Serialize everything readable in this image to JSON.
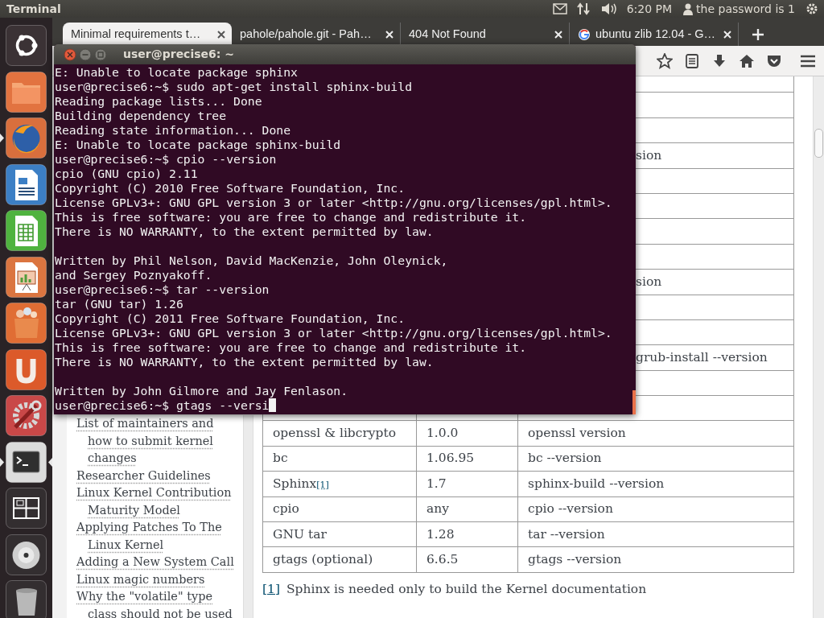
{
  "top_panel": {
    "app_title": "Terminal",
    "clock": "6:20 PM",
    "user_name": "the password is 1"
  },
  "launcher": [
    {
      "kind": "dash",
      "running": false,
      "focused": false
    },
    {
      "kind": "files",
      "running": false,
      "focused": false
    },
    {
      "kind": "firefox",
      "running": true,
      "focused": false
    },
    {
      "kind": "writer",
      "running": false,
      "focused": false
    },
    {
      "kind": "calc",
      "running": false,
      "focused": false
    },
    {
      "kind": "impress",
      "running": false,
      "focused": false
    },
    {
      "kind": "software",
      "running": false,
      "focused": false
    },
    {
      "kind": "ubuntuone",
      "running": false,
      "focused": false
    },
    {
      "kind": "settings",
      "running": false,
      "focused": false
    },
    {
      "kind": "terminal",
      "running": true,
      "focused": true
    },
    {
      "kind": "workspaces",
      "running": false,
      "focused": false
    },
    {
      "kind": "dvd",
      "running": false,
      "focused": false
    },
    {
      "kind": "trash",
      "running": false,
      "focused": false
    }
  ],
  "browser": {
    "tabs": [
      {
        "title": "Minimal requirements t…",
        "selected": true
      },
      {
        "title": "pahole/pahole.git - Pah…",
        "selected": false
      },
      {
        "title": "404 Not Found",
        "selected": false
      },
      {
        "title": "ubuntu zlib 12.04 - G…",
        "selected": false,
        "has_favicon": true
      }
    ],
    "sidebar_links": [
      "List of maintainers and how to submit kernel changes",
      "Researcher Guidelines",
      "Linux Kernel Contribution Maturity Model",
      "Applying Patches To The Linux Kernel",
      "Adding a New System Call",
      "Linux magic numbers",
      "Why the \"volatile\" type class should not be used"
    ],
    "table": {
      "rows": [
        {
          "covered": true
        },
        {
          "covered": true
        },
        {
          "covered": true
        },
        {
          "covered": true,
          "column_3": "sion"
        },
        {
          "covered": true
        },
        {
          "covered": true
        },
        {
          "covered": true
        },
        {
          "covered": true
        },
        {
          "covered": true,
          "column_3": "sion"
        },
        {
          "covered": true
        },
        {
          "covered": true
        },
        {
          "covered": true,
          "column_3": "grub-install --version"
        },
        {
          "covered": true
        },
        {
          "covered": true
        },
        {
          "covered": false,
          "cells": [
            "openssl & libcrypto",
            "1.0.0",
            "openssl version"
          ]
        },
        {
          "covered": false,
          "cells": [
            "bc",
            "1.06.95",
            "bc --version"
          ]
        },
        {
          "covered": false,
          "cells": [
            "Sphinx",
            "1.7",
            "sphinx-build --version"
          ],
          "footnote_ref": "[1]"
        },
        {
          "covered": false,
          "cells": [
            "cpio",
            "any",
            "cpio --version"
          ]
        },
        {
          "covered": false,
          "cells": [
            "GNU tar",
            "1.28",
            "tar --version"
          ]
        },
        {
          "covered": false,
          "cells": [
            "gtags (optional)",
            "6.6.5",
            "gtags --version"
          ]
        }
      ]
    },
    "footnote": {
      "ref": "[1]",
      "text": "Sphinx is needed only to build the Kernel documentation"
    }
  },
  "terminal": {
    "title": "user@precise6: ~",
    "lines": [
      {
        "kind": "output",
        "text": "E: Unable to locate package sphinx"
      },
      {
        "kind": "output",
        "text": "user@precise6:~$ sudo apt-get install sphinx-build"
      },
      {
        "kind": "output",
        "text": "Reading package lists... Done"
      },
      {
        "kind": "output",
        "text": "Building dependency tree"
      },
      {
        "kind": "output",
        "text": "Reading state information... Done"
      },
      {
        "kind": "output",
        "text": "E: Unable to locate package sphinx-build"
      },
      {
        "kind": "output",
        "text": "user@precise6:~$ cpio --version"
      },
      {
        "kind": "output",
        "text": "cpio (GNU cpio) 2.11"
      },
      {
        "kind": "output",
        "text": "Copyright (C) 2010 Free Software Foundation, Inc."
      },
      {
        "kind": "output",
        "text": "License GPLv3+: GNU GPL version 3 or later <http://gnu.org/licenses/gpl.html>."
      },
      {
        "kind": "output",
        "text": "This is free software: you are free to change and redistribute it."
      },
      {
        "kind": "output",
        "text": "There is NO WARRANTY, to the extent permitted by law."
      },
      {
        "kind": "blank"
      },
      {
        "kind": "output",
        "text": "Written by Phil Nelson, David MacKenzie, John Oleynick,"
      },
      {
        "kind": "output",
        "text": "and Sergey Poznyakoff."
      },
      {
        "kind": "output",
        "text": "user@precise6:~$ tar --version"
      },
      {
        "kind": "output",
        "text": "tar (GNU tar) 1.26"
      },
      {
        "kind": "output",
        "text": "Copyright (C) 2011 Free Software Foundation, Inc."
      },
      {
        "kind": "output",
        "text": "License GPLv3+: GNU GPL version 3 or later <http://gnu.org/licenses/gpl.html>."
      },
      {
        "kind": "output",
        "text": "This is free software: you are free to change and redistribute it."
      },
      {
        "kind": "output",
        "text": "There is NO WARRANTY, to the extent permitted by law."
      },
      {
        "kind": "blank"
      },
      {
        "kind": "output",
        "text": "Written by John Gilmore and Jay Fenlason."
      },
      {
        "kind": "input",
        "text": "user@precise6:~$ gtags --versi"
      }
    ]
  }
}
